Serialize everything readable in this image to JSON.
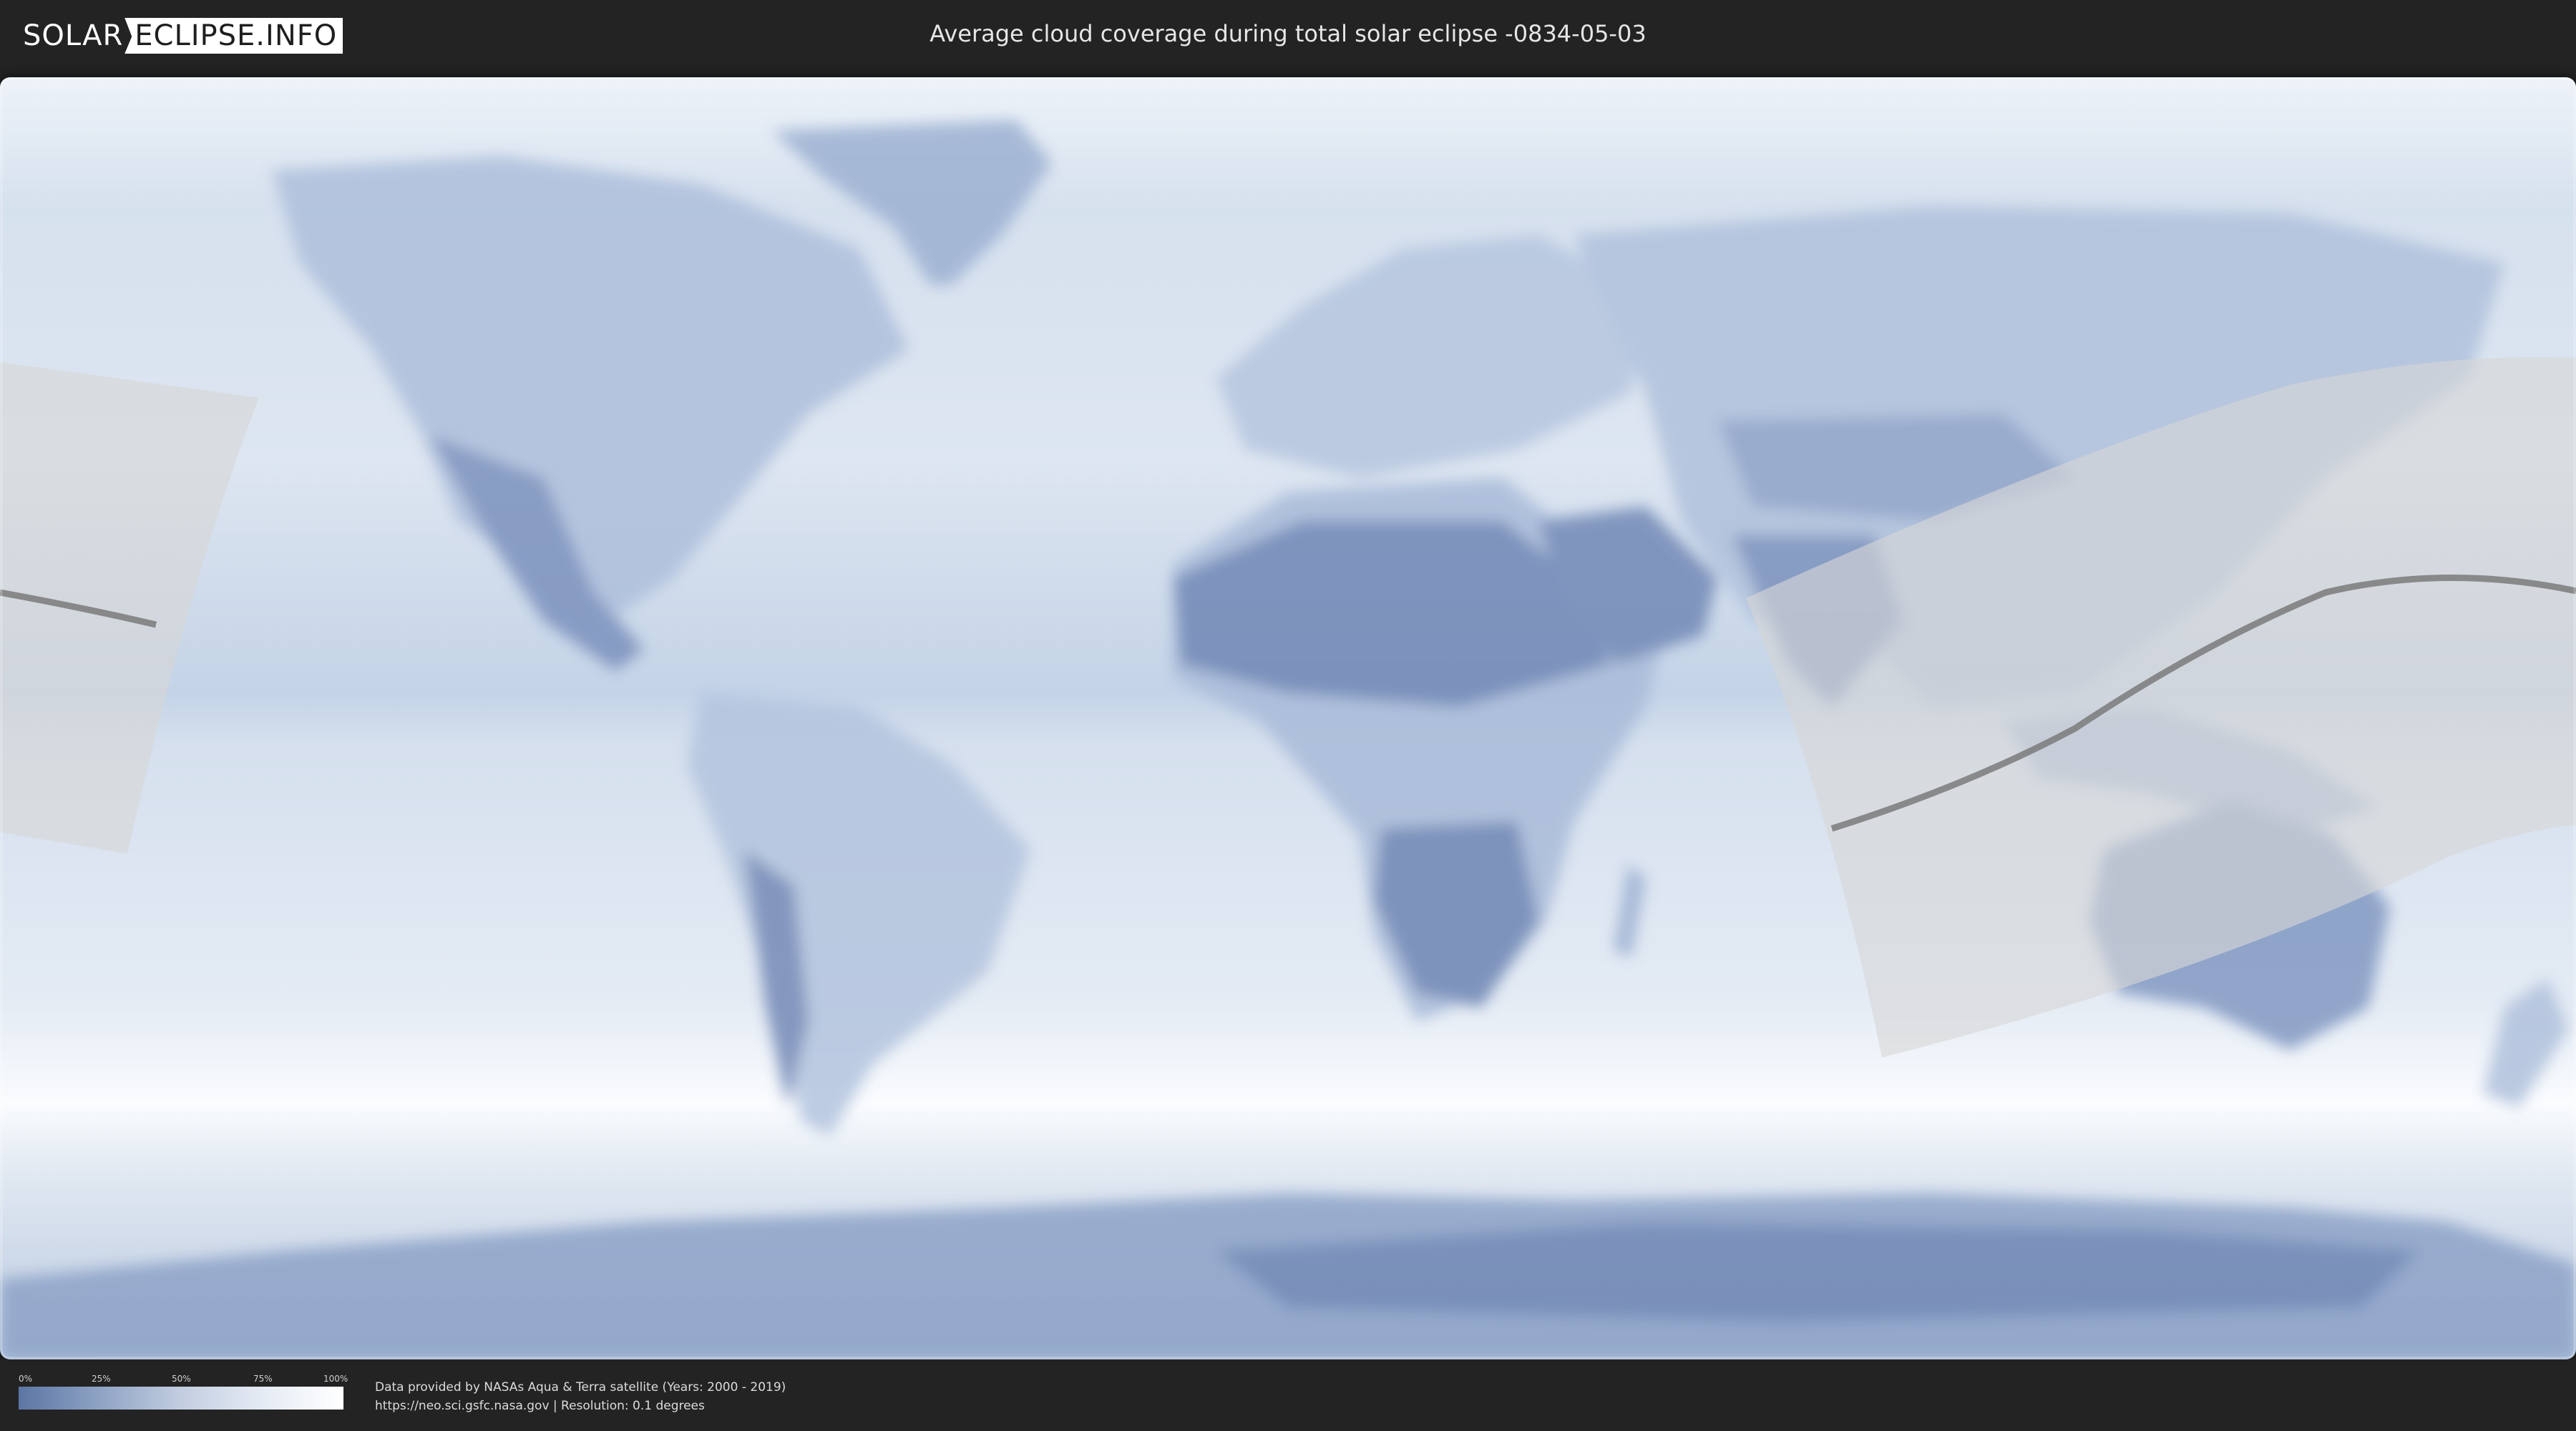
{
  "header": {
    "logo_left": "SOLAR",
    "logo_right": "ECLIPSE.INFO",
    "title": "Average cloud coverage during total solar eclipse -0834-05-03"
  },
  "legend": {
    "ticks": [
      "0%",
      "25%",
      "50%",
      "75%",
      "100%"
    ],
    "colors": {
      "low": "#5c76a4",
      "high": "#ffffff"
    }
  },
  "footer": {
    "credit_line": "Data provided by NASAs Aqua & Terra satellite (Years: 2000 - 2019)",
    "source_line": "https://neo.sci.gsfc.nasa.gov | Resolution: 0.1 degrees"
  },
  "map": {
    "projection": "equirectangular",
    "layer": "average cloud coverage",
    "overlays": [
      "eclipse-visibility-zone",
      "totality-path-line"
    ],
    "colors": {
      "ocean_cloud": "#c9d7ea",
      "land_clear": "#6d86b3",
      "eclipse_zone": "#d6d6d6",
      "path_line": "#7a7a7a"
    }
  }
}
